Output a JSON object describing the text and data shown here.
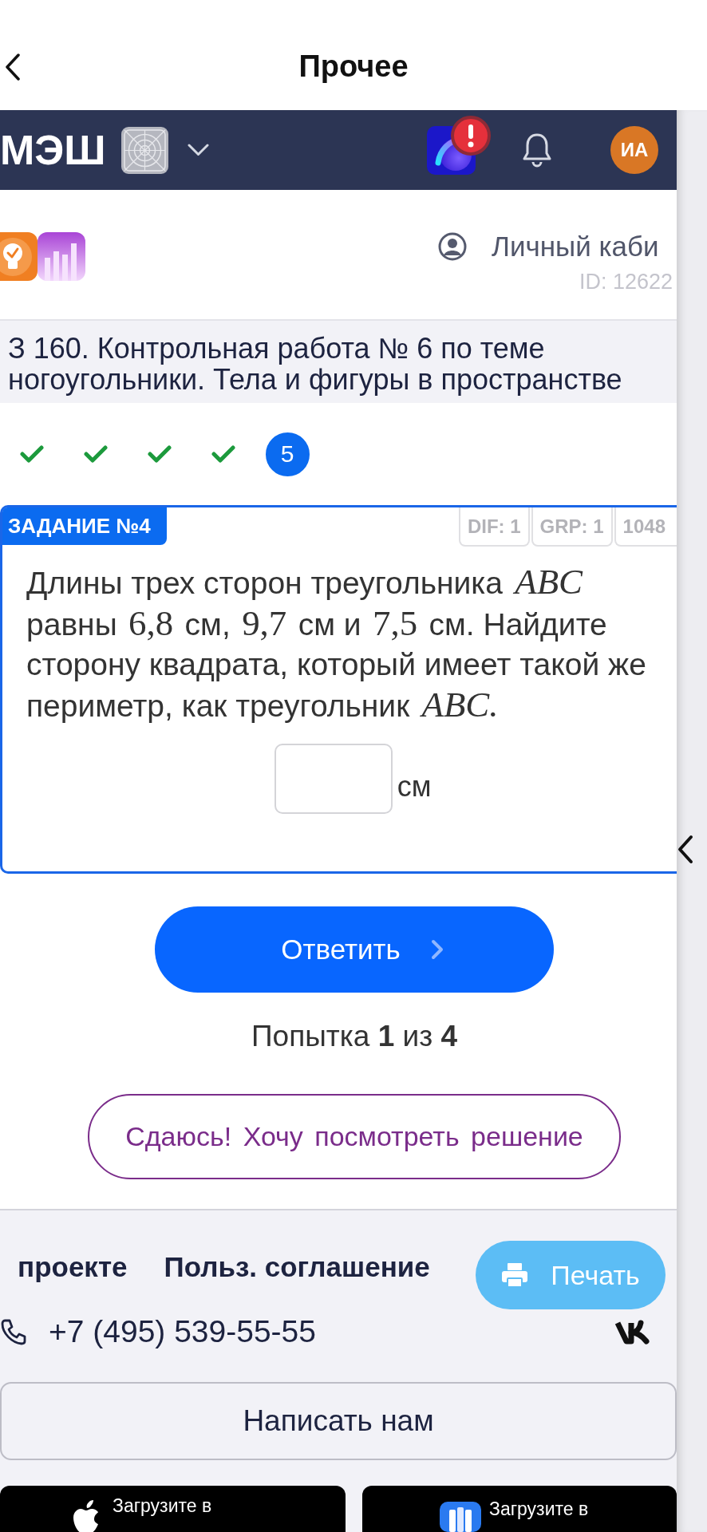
{
  "top_bar": {
    "title": "Прочее"
  },
  "navbar": {
    "logo_text": "МЭШ",
    "alert": true,
    "avatar_initials": "ИА"
  },
  "header": {
    "account_link": "Личный каби",
    "user_id": "ID: 12622"
  },
  "task_title": {
    "lines": [
      "З 160. Контрольная работа № 6 по теме",
      "ногоугольники. Тела и фигуры в пространстве"
    ]
  },
  "steps": [
    {
      "kind": "done",
      "selected": false
    },
    {
      "kind": "done",
      "selected": false
    },
    {
      "kind": "done",
      "selected": false
    },
    {
      "kind": "done",
      "selected": false
    },
    {
      "kind": "current",
      "label": "5",
      "selected": true
    }
  ],
  "task": {
    "badge": "ЗАДАНИЕ №4",
    "tags": [
      "DIF: 1",
      "GRP: 1",
      "1048"
    ],
    "question": [
      {
        "kind": "text",
        "text": "Длины трех сторон треугольника"
      },
      {
        "kind": "math_var",
        "text": "ABC"
      },
      {
        "kind": "text",
        "text": "равны"
      },
      {
        "kind": "math_num",
        "text": "6,8"
      },
      {
        "kind": "text",
        "text": "см,"
      },
      {
        "kind": "math_num",
        "text": "9,7"
      },
      {
        "kind": "text",
        "text": "см и"
      },
      {
        "kind": "math_num",
        "text": "7,5"
      },
      {
        "kind": "text",
        "text": "см. Найдите сторону квадрата, который имеет такой же периметр, как треугольник"
      },
      {
        "kind": "math_var",
        "text": "ABC."
      }
    ],
    "unit": "см"
  },
  "submit_button": "Ответить",
  "attempt": "Попытка **1** из **4**",
  "give_up_button": "Сдаюсь! Хочу посмотреть решение",
  "footer": {
    "links": [
      "проекте",
      "Польз. соглашение"
    ],
    "print_button": "Печать",
    "phone": "+7 (495) 539-55-55",
    "write_button": "Написать нам",
    "store_buttons": [
      {
        "kind": "apple",
        "caption": "Загрузите в"
      },
      {
        "kind": "rustore",
        "caption": "Загрузите в"
      }
    ]
  }
}
